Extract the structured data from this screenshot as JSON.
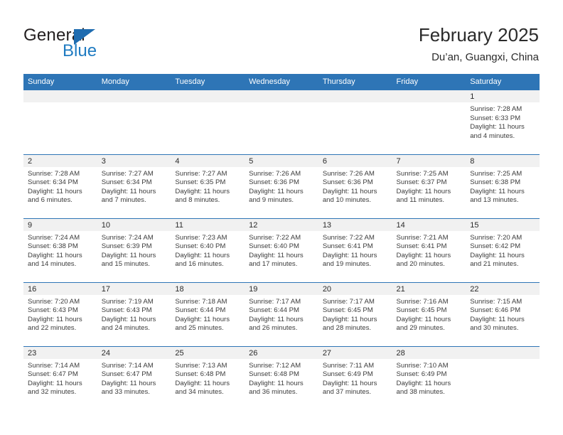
{
  "brand": {
    "name_part1": "General",
    "name_part2": "Blue",
    "triangle_color": "#1f6cb0",
    "blue_color": "#1f7bc1"
  },
  "header": {
    "title": "February 2025",
    "subtitle": "Du’an, Guangxi, China",
    "accent_color": "#2e75b6",
    "daynum_bg": "#f1f1f1"
  },
  "calendar": {
    "day_headers": [
      "Sunday",
      "Monday",
      "Tuesday",
      "Wednesday",
      "Thursday",
      "Friday",
      "Saturday"
    ],
    "weeks": [
      [
        {
          "day": "",
          "blank": true
        },
        {
          "day": "",
          "blank": true
        },
        {
          "day": "",
          "blank": true
        },
        {
          "day": "",
          "blank": true
        },
        {
          "day": "",
          "blank": true
        },
        {
          "day": "",
          "blank": true
        },
        {
          "day": "1",
          "sunrise": "Sunrise: 7:28 AM",
          "sunset": "Sunset: 6:33 PM",
          "daylight": "Daylight: 11 hours and 4 minutes."
        }
      ],
      [
        {
          "day": "2",
          "sunrise": "Sunrise: 7:28 AM",
          "sunset": "Sunset: 6:34 PM",
          "daylight": "Daylight: 11 hours and 6 minutes."
        },
        {
          "day": "3",
          "sunrise": "Sunrise: 7:27 AM",
          "sunset": "Sunset: 6:34 PM",
          "daylight": "Daylight: 11 hours and 7 minutes."
        },
        {
          "day": "4",
          "sunrise": "Sunrise: 7:27 AM",
          "sunset": "Sunset: 6:35 PM",
          "daylight": "Daylight: 11 hours and 8 minutes."
        },
        {
          "day": "5",
          "sunrise": "Sunrise: 7:26 AM",
          "sunset": "Sunset: 6:36 PM",
          "daylight": "Daylight: 11 hours and 9 minutes."
        },
        {
          "day": "6",
          "sunrise": "Sunrise: 7:26 AM",
          "sunset": "Sunset: 6:36 PM",
          "daylight": "Daylight: 11 hours and 10 minutes."
        },
        {
          "day": "7",
          "sunrise": "Sunrise: 7:25 AM",
          "sunset": "Sunset: 6:37 PM",
          "daylight": "Daylight: 11 hours and 11 minutes."
        },
        {
          "day": "8",
          "sunrise": "Sunrise: 7:25 AM",
          "sunset": "Sunset: 6:38 PM",
          "daylight": "Daylight: 11 hours and 13 minutes."
        }
      ],
      [
        {
          "day": "9",
          "sunrise": "Sunrise: 7:24 AM",
          "sunset": "Sunset: 6:38 PM",
          "daylight": "Daylight: 11 hours and 14 minutes."
        },
        {
          "day": "10",
          "sunrise": "Sunrise: 7:24 AM",
          "sunset": "Sunset: 6:39 PM",
          "daylight": "Daylight: 11 hours and 15 minutes."
        },
        {
          "day": "11",
          "sunrise": "Sunrise: 7:23 AM",
          "sunset": "Sunset: 6:40 PM",
          "daylight": "Daylight: 11 hours and 16 minutes."
        },
        {
          "day": "12",
          "sunrise": "Sunrise: 7:22 AM",
          "sunset": "Sunset: 6:40 PM",
          "daylight": "Daylight: 11 hours and 17 minutes."
        },
        {
          "day": "13",
          "sunrise": "Sunrise: 7:22 AM",
          "sunset": "Sunset: 6:41 PM",
          "daylight": "Daylight: 11 hours and 19 minutes."
        },
        {
          "day": "14",
          "sunrise": "Sunrise: 7:21 AM",
          "sunset": "Sunset: 6:41 PM",
          "daylight": "Daylight: 11 hours and 20 minutes."
        },
        {
          "day": "15",
          "sunrise": "Sunrise: 7:20 AM",
          "sunset": "Sunset: 6:42 PM",
          "daylight": "Daylight: 11 hours and 21 minutes."
        }
      ],
      [
        {
          "day": "16",
          "sunrise": "Sunrise: 7:20 AM",
          "sunset": "Sunset: 6:43 PM",
          "daylight": "Daylight: 11 hours and 22 minutes."
        },
        {
          "day": "17",
          "sunrise": "Sunrise: 7:19 AM",
          "sunset": "Sunset: 6:43 PM",
          "daylight": "Daylight: 11 hours and 24 minutes."
        },
        {
          "day": "18",
          "sunrise": "Sunrise: 7:18 AM",
          "sunset": "Sunset: 6:44 PM",
          "daylight": "Daylight: 11 hours and 25 minutes."
        },
        {
          "day": "19",
          "sunrise": "Sunrise: 7:17 AM",
          "sunset": "Sunset: 6:44 PM",
          "daylight": "Daylight: 11 hours and 26 minutes."
        },
        {
          "day": "20",
          "sunrise": "Sunrise: 7:17 AM",
          "sunset": "Sunset: 6:45 PM",
          "daylight": "Daylight: 11 hours and 28 minutes."
        },
        {
          "day": "21",
          "sunrise": "Sunrise: 7:16 AM",
          "sunset": "Sunset: 6:45 PM",
          "daylight": "Daylight: 11 hours and 29 minutes."
        },
        {
          "day": "22",
          "sunrise": "Sunrise: 7:15 AM",
          "sunset": "Sunset: 6:46 PM",
          "daylight": "Daylight: 11 hours and 30 minutes."
        }
      ],
      [
        {
          "day": "23",
          "sunrise": "Sunrise: 7:14 AM",
          "sunset": "Sunset: 6:47 PM",
          "daylight": "Daylight: 11 hours and 32 minutes."
        },
        {
          "day": "24",
          "sunrise": "Sunrise: 7:14 AM",
          "sunset": "Sunset: 6:47 PM",
          "daylight": "Daylight: 11 hours and 33 minutes."
        },
        {
          "day": "25",
          "sunrise": "Sunrise: 7:13 AM",
          "sunset": "Sunset: 6:48 PM",
          "daylight": "Daylight: 11 hours and 34 minutes."
        },
        {
          "day": "26",
          "sunrise": "Sunrise: 7:12 AM",
          "sunset": "Sunset: 6:48 PM",
          "daylight": "Daylight: 11 hours and 36 minutes."
        },
        {
          "day": "27",
          "sunrise": "Sunrise: 7:11 AM",
          "sunset": "Sunset: 6:49 PM",
          "daylight": "Daylight: 11 hours and 37 minutes."
        },
        {
          "day": "28",
          "sunrise": "Sunrise: 7:10 AM",
          "sunset": "Sunset: 6:49 PM",
          "daylight": "Daylight: 11 hours and 38 minutes."
        },
        {
          "day": "",
          "blank": true
        }
      ]
    ]
  }
}
